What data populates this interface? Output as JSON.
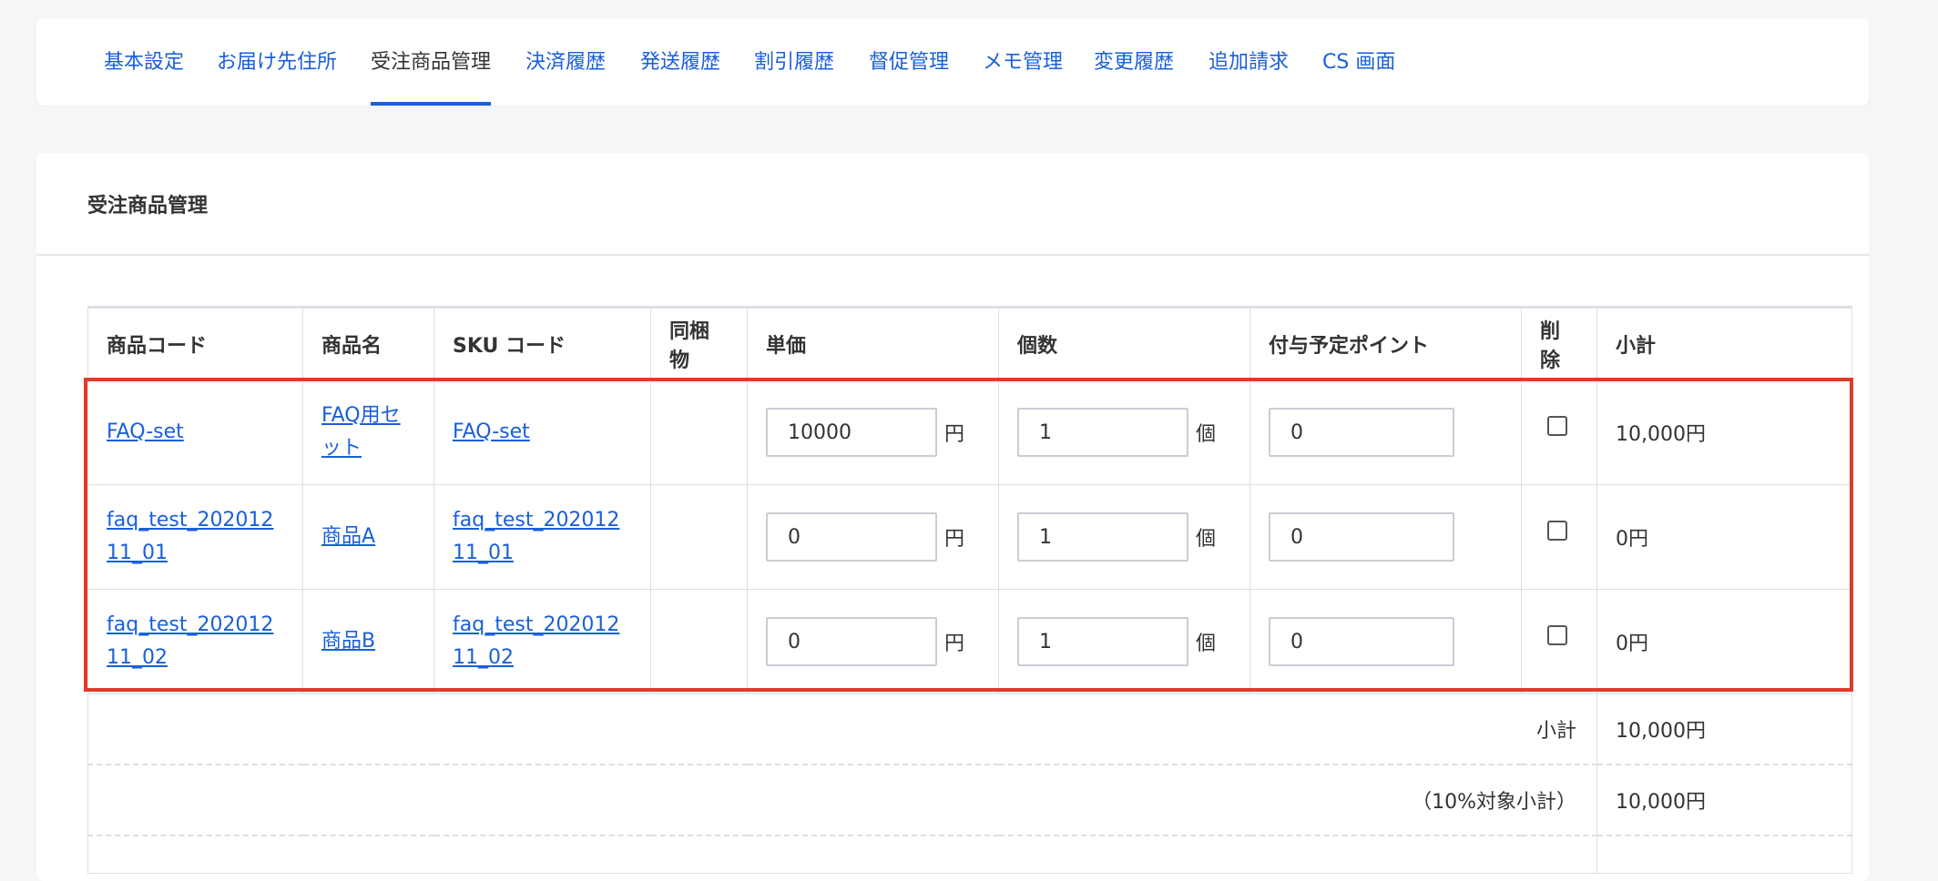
{
  "tabs": [
    {
      "label": "基本設定"
    },
    {
      "label": "お届け先住所"
    },
    {
      "label": "受注商品管理"
    },
    {
      "label": "決済履歴"
    },
    {
      "label": "発送履歴"
    },
    {
      "label": "割引履歴"
    },
    {
      "label": "督促管理"
    },
    {
      "label": "メモ管理"
    },
    {
      "label": "変更履歴"
    },
    {
      "label": "追加請求"
    },
    {
      "label": "CS 画面"
    }
  ],
  "active_tab": "受注商品管理",
  "card_title": "受注商品管理",
  "table": {
    "headers": {
      "code": "商品コード",
      "name": "商品名",
      "sku": "SKU コード",
      "bundle": "同梱物",
      "price": "単価",
      "qty": "個数",
      "points": "付与予定ポイント",
      "delete": "削除",
      "subtotal": "小計"
    },
    "units": {
      "yen": "円",
      "piece": "個"
    },
    "rows": [
      {
        "code": "FAQ-set",
        "name": "FAQ用セット",
        "sku": "FAQ-set",
        "bundle": "",
        "price": "10000",
        "qty": "1",
        "points": "0",
        "checked": false,
        "subtotal": "10,000円"
      },
      {
        "code": "faq_test_20201211_01",
        "name": "商品A",
        "sku": "faq_test_20201211_01",
        "bundle": "",
        "price": "0",
        "qty": "1",
        "points": "0",
        "checked": false,
        "subtotal": "0円"
      },
      {
        "code": "faq_test_20201211_02",
        "name": "商品B",
        "sku": "faq_test_20201211_02",
        "bundle": "",
        "price": "0",
        "qty": "1",
        "points": "0",
        "checked": false,
        "subtotal": "0円"
      }
    ],
    "summary": [
      {
        "label": "小計",
        "value": "10,000円"
      },
      {
        "label": "（10%対象小計）",
        "value": "10,000円"
      }
    ]
  },
  "colors": {
    "link": "#1a5fd8",
    "highlight": "#e23b2a"
  }
}
